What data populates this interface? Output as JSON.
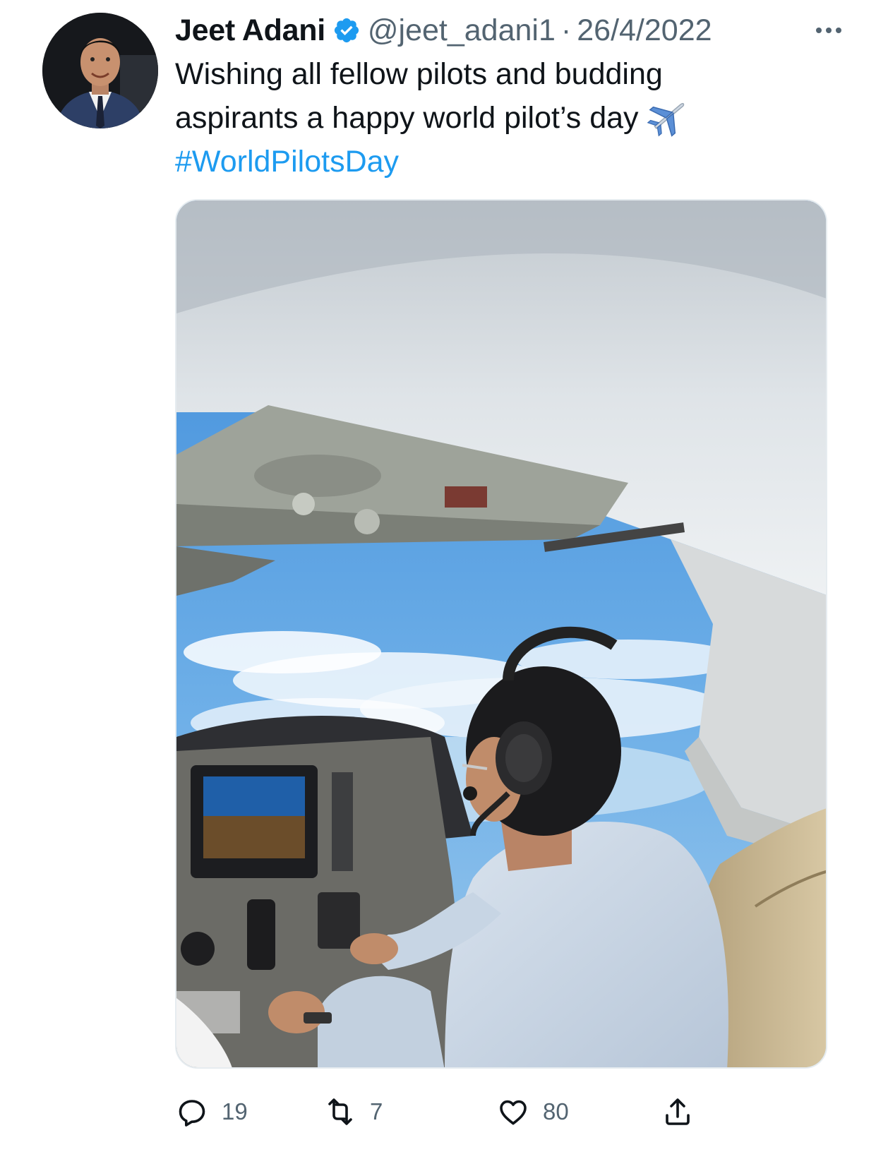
{
  "tweet": {
    "author_name": "Jeet Adani",
    "handle": "@jeet_adani1",
    "separator": "·",
    "date": "26/4/2022",
    "text_lines": [
      "Wishing all fellow pilots and budding",
      "aspirants a happy world pilot’s day"
    ],
    "hashtag": "#WorldPilotsDay",
    "emoji": "airplane-emoji",
    "media_description_icon": "cockpit-photo"
  },
  "actions": {
    "reply_count": "19",
    "retweet_count": "7",
    "like_count": "80"
  },
  "colors": {
    "text": "#0f1419",
    "secondary": "#536471",
    "accent": "#1d9bf0"
  }
}
